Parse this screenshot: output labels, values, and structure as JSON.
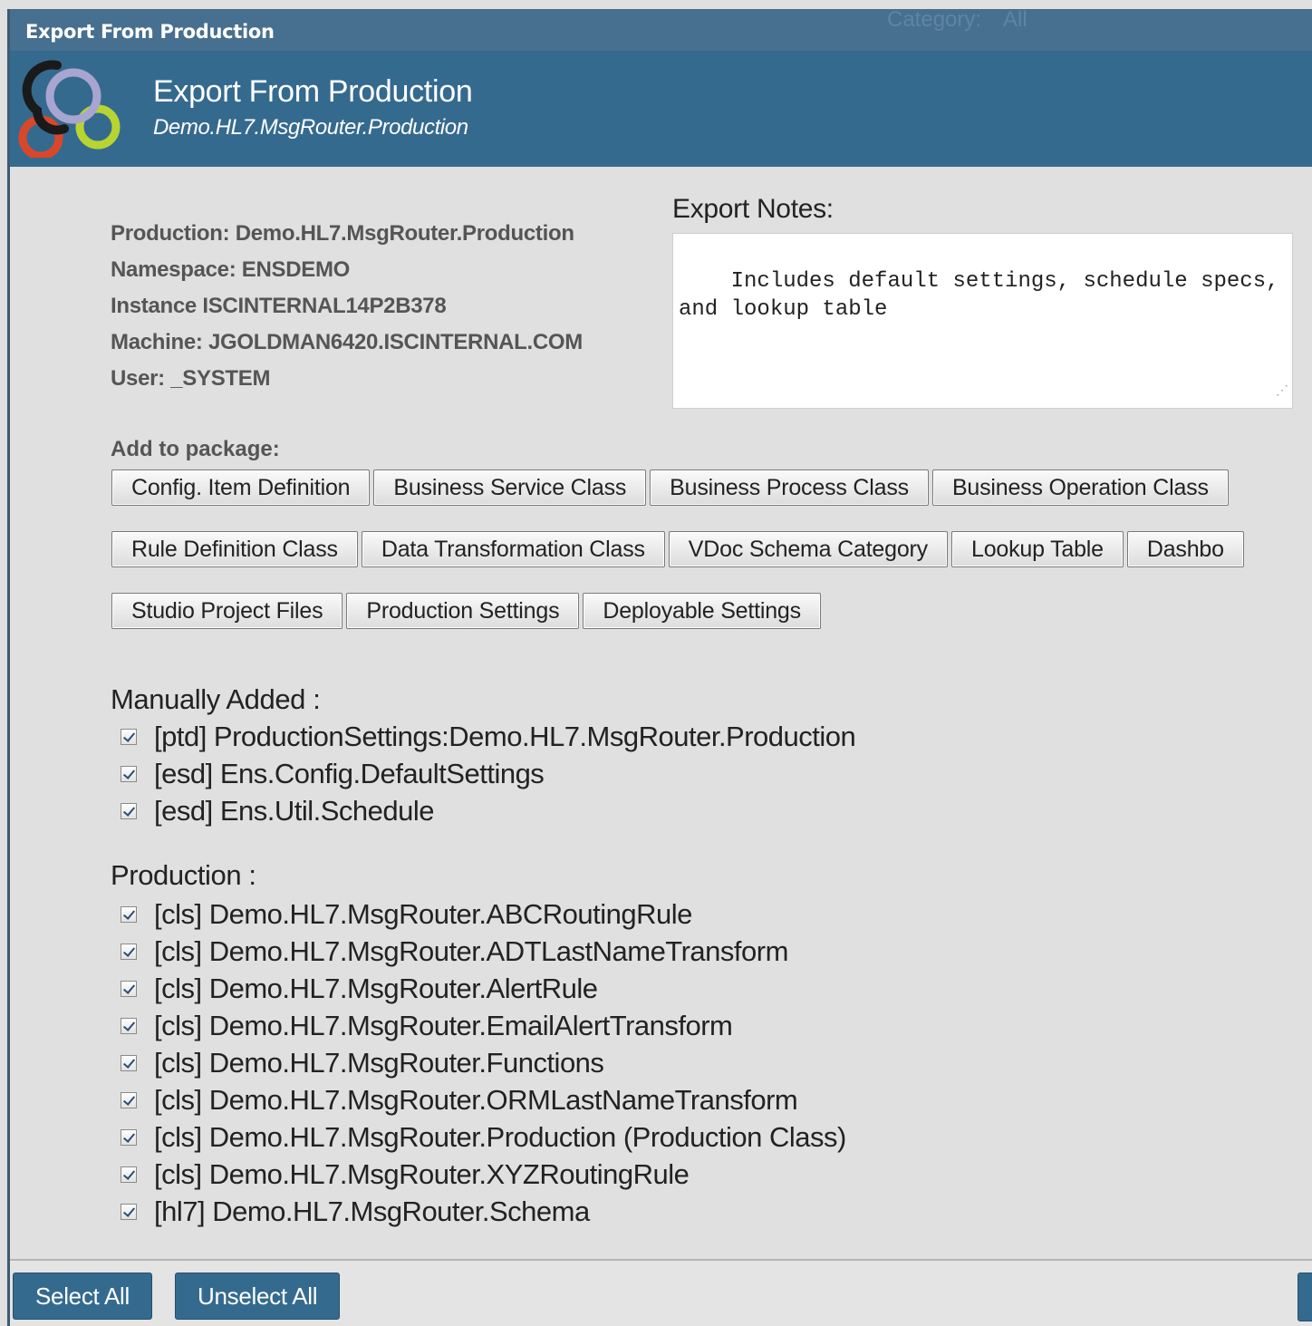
{
  "window": {
    "title": "Export From Production"
  },
  "header": {
    "title": "Export From Production",
    "subtitle": "Demo.HL7.MsgRouter.Production"
  },
  "info": {
    "production": "Production: Demo.HL7.MsgRouter.Production",
    "namespace": "Namespace: ENSDEMO",
    "instance": "Instance ISCINTERNAL14P2B378",
    "machine": "Machine: JGOLDMAN6420.ISCINTERNAL.COM",
    "user": "User: _SYSTEM"
  },
  "notes": {
    "label": "Export Notes:",
    "value": "Includes default settings, schedule specs, and lookup table"
  },
  "add_to_package": {
    "label": "Add to package:",
    "row1": [
      "Config. Item Definition",
      "Business Service Class",
      "Business Process Class",
      "Business Operation Class"
    ],
    "row2": [
      "Rule Definition Class",
      "Data Transformation Class",
      "VDoc Schema Category",
      "Lookup Table",
      "Dashbo"
    ],
    "row3": [
      "Studio Project Files",
      "Production Settings",
      "Deployable Settings"
    ]
  },
  "manually_added": {
    "label": "Manually Added :",
    "items": [
      {
        "label": "[ptd] ProductionSettings:Demo.HL7.MsgRouter.Production",
        "checked": true
      },
      {
        "label": "[esd] Ens.Config.DefaultSettings",
        "checked": true
      },
      {
        "label": "[esd] Ens.Util.Schedule",
        "checked": true
      }
    ]
  },
  "production": {
    "label": "Production :",
    "items": [
      {
        "label": "[cls] Demo.HL7.MsgRouter.ABCRoutingRule",
        "checked": true
      },
      {
        "label": "[cls] Demo.HL7.MsgRouter.ADTLastNameTransform",
        "checked": true
      },
      {
        "label": "[cls] Demo.HL7.MsgRouter.AlertRule",
        "checked": true
      },
      {
        "label": "[cls] Demo.HL7.MsgRouter.EmailAlertTransform",
        "checked": true
      },
      {
        "label": "[cls] Demo.HL7.MsgRouter.Functions",
        "checked": true
      },
      {
        "label": "[cls] Demo.HL7.MsgRouter.ORMLastNameTransform",
        "checked": true
      },
      {
        "label": "[cls] Demo.HL7.MsgRouter.Production (Production Class)",
        "checked": true
      },
      {
        "label": "[cls] Demo.HL7.MsgRouter.XYZRoutingRule",
        "checked": true
      },
      {
        "label": "[hl7] Demo.HL7.MsgRouter.Schema",
        "checked": true
      }
    ]
  },
  "footer": {
    "select_all": "Select All",
    "unselect_all": "Unselect All"
  },
  "background": {
    "category_label": "Category:",
    "category_value": "All"
  },
  "colors": {
    "title_bar": "#476f8f",
    "header": "#356a8f",
    "panel": "#e0e0e0",
    "logo_red": "#d9472b",
    "logo_lime": "#b8d432",
    "logo_lavender": "#a8a5d0",
    "logo_black": "#1a1a1a"
  }
}
